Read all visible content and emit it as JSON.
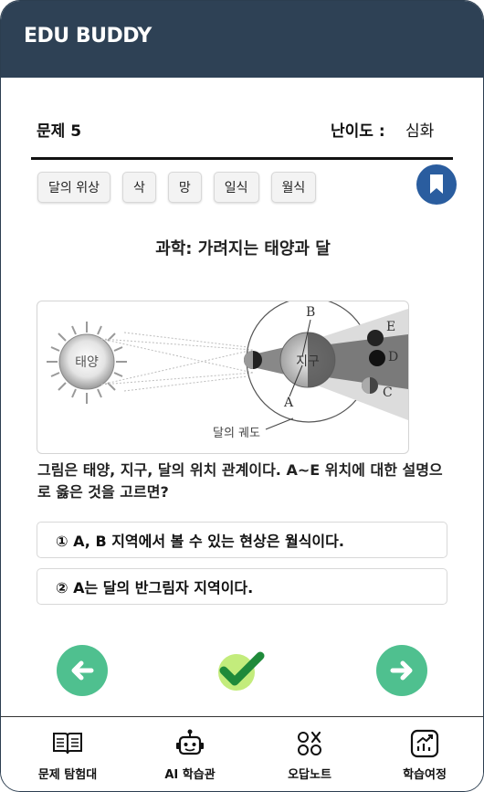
{
  "app": {
    "title": "EDU BUDDY"
  },
  "question_header": {
    "number_label": "문제 5",
    "difficulty_label": "난이도 :",
    "difficulty_value": "심화"
  },
  "tags": [
    "달의 위상",
    "삭",
    "망",
    "일식",
    "월식"
  ],
  "subject_title": "과학: 가려지는 태양과 달",
  "figure": {
    "sun_label": "태양",
    "earth_label": "지구",
    "orbit_label": "달의  궤도",
    "positions": [
      "A",
      "B",
      "C",
      "D",
      "E"
    ]
  },
  "question_text": "그림은 태양, 지구, 달의 위치 관계이다. A~E 위치에 대한 설명으로 옳은 것을 고르면?",
  "options": [
    "① A, B 지역에서 볼 수 있는 현상은 월식이다.",
    "② A는 달의 반그림자 지역이다."
  ],
  "nav": {
    "prev_icon": "arrow-left-icon",
    "check_icon": "checkmark-icon",
    "next_icon": "arrow-right-icon"
  },
  "tabbar": [
    {
      "label": "문제 탐험대",
      "icon": "book-icon"
    },
    {
      "label": "AI 학습관",
      "icon": "robot-icon"
    },
    {
      "label": "오답노트",
      "icon": "circles-x-icon"
    },
    {
      "label": "학습여정",
      "icon": "chart-up-icon"
    }
  ],
  "colors": {
    "appbar": "#2e4155",
    "accent_blue": "#2a5d9f",
    "nav_green": "#4fc08f",
    "check_green": "#1f8a3a"
  }
}
